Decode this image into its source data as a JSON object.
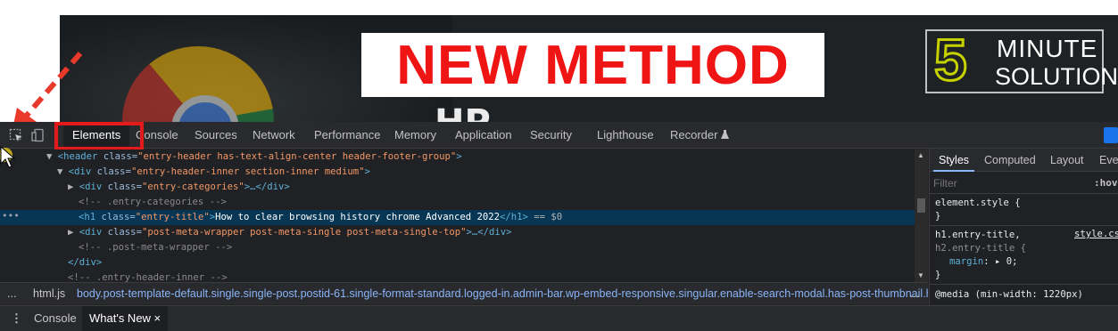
{
  "banner": {
    "title": "NEW METHOD",
    "background_text": "HP",
    "logo_digit": "5",
    "logo_line1": "MINUTE",
    "logo_line2": "SOLUTION"
  },
  "devtools": {
    "tabs": [
      "Elements",
      "Console",
      "Sources",
      "Network",
      "Performance",
      "Memory",
      "Application",
      "Security",
      "Lighthouse",
      "Recorder"
    ],
    "active_tab": "Elements",
    "recorder_icon": "flask-icon",
    "dom_lines": {
      "l1": {
        "tag_open": "<header",
        "attr": " class=",
        "val": "\"entry-header has-text-align-center header-footer-group\"",
        "close": ">"
      },
      "l2": {
        "tag_open": "<div",
        "attr": " class=",
        "val": "\"entry-header-inner section-inner medium\"",
        "close": ">"
      },
      "l3": {
        "tag_open": "<div",
        "attr": " class=",
        "val": "\"entry-categories\"",
        "close": ">…</div>"
      },
      "l4": {
        "comment": "<!-- .entry-categories -->"
      },
      "l5": {
        "tag_open": "<h1",
        "attr": " class=",
        "val": "\"entry-title\"",
        "close": ">",
        "text": "How to clear browsing history chrome Advanced 2022",
        "end": "</h1>",
        "suffix": " == $0"
      },
      "l6": {
        "tag_open": "<div",
        "attr": " class=",
        "val": "\"post-meta-wrapper post-meta-single post-meta-single-top\"",
        "close": ">…</div>"
      },
      "l7": {
        "comment": "<!-- .post-meta-wrapper -->"
      },
      "l8": {
        "tag": "</div>"
      },
      "l9": {
        "comment": "<!-- .entry-header-inner -->"
      }
    },
    "breadcrumb": {
      "dots": "...",
      "html": "html.js",
      "body": "body.post-template-default.single.single-post.postid-61.single-format-standard.logged-in.admin-bar.wp-embed-responsive.singular.enable-search-modal.has-post-thumbnail.h",
      "more": "..."
    },
    "drawer": {
      "menu": "⋮",
      "console": "Console",
      "whats_new": "What's New ×"
    },
    "styles": {
      "tabs": [
        "Styles",
        "Computed",
        "Layout",
        "Eve"
      ],
      "filter_placeholder": "Filter",
      "hov": ":hov",
      "element_style": "element.style {",
      "close_brace": "}",
      "rule_selector": "h1.entry-title,",
      "rule_selector2": "h2.entry-title {",
      "rule_source": "style.cs",
      "rule_prop": "margin",
      "rule_value": ": ▸ 0;",
      "media": "@media (min-width: 1220px)"
    }
  }
}
